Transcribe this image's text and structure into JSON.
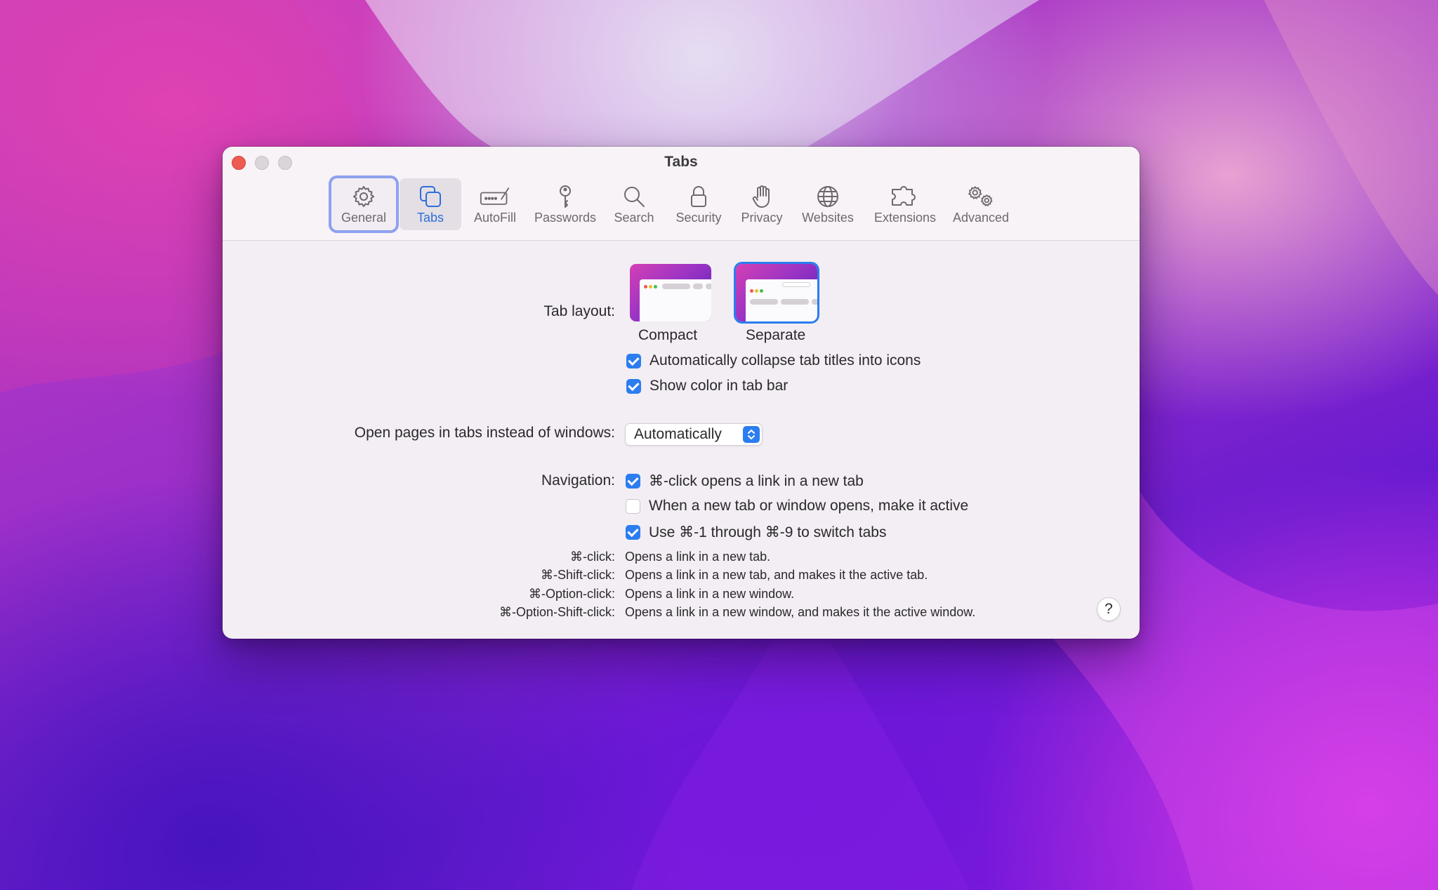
{
  "window": {
    "title": "Tabs"
  },
  "toolbar": {
    "items": [
      {
        "label": "General",
        "icon": "gear-icon"
      },
      {
        "label": "Tabs",
        "icon": "tabs-icon"
      },
      {
        "label": "AutoFill",
        "icon": "autofill-icon"
      },
      {
        "label": "Passwords",
        "icon": "key-icon"
      },
      {
        "label": "Search",
        "icon": "search-icon"
      },
      {
        "label": "Security",
        "icon": "lock-icon"
      },
      {
        "label": "Privacy",
        "icon": "hand-icon"
      },
      {
        "label": "Websites",
        "icon": "globe-icon"
      },
      {
        "label": "Extensions",
        "icon": "puzzle-icon"
      },
      {
        "label": "Advanced",
        "icon": "gears-icon"
      }
    ],
    "selected": "Tabs",
    "focused": "General"
  },
  "tab_layout": {
    "label": "Tab layout:",
    "options": [
      {
        "name": "Compact",
        "selected": false
      },
      {
        "name": "Separate",
        "selected": true
      }
    ],
    "checkboxes": [
      {
        "label": "Automatically collapse tab titles into icons",
        "checked": true
      },
      {
        "label": "Show color in tab bar",
        "checked": true
      }
    ]
  },
  "open_pages": {
    "label": "Open pages in tabs instead of windows:",
    "value": "Automatically"
  },
  "navigation": {
    "label": "Navigation:",
    "checkboxes": [
      {
        "label": "⌘-click opens a link in a new tab",
        "checked": true
      },
      {
        "label": "When a new tab or window opens, make it active",
        "checked": false
      },
      {
        "label": "Use ⌘-1 through ⌘-9 to switch tabs",
        "checked": true
      }
    ]
  },
  "shortcuts": [
    {
      "key": "⌘-click:",
      "desc": "Opens a link in a new tab."
    },
    {
      "key": "⌘-Shift-click:",
      "desc": "Opens a link in a new tab, and makes it the active tab."
    },
    {
      "key": "⌘-Option-click:",
      "desc": "Opens a link in a new window."
    },
    {
      "key": "⌘-Option-Shift-click:",
      "desc": "Opens a link in a new window, and makes it the active window."
    }
  ],
  "help": {
    "label": "?"
  },
  "colors": {
    "accent": "#2b7df0",
    "focus_ring": "#8ea1ef",
    "close": "#ee5b50"
  }
}
